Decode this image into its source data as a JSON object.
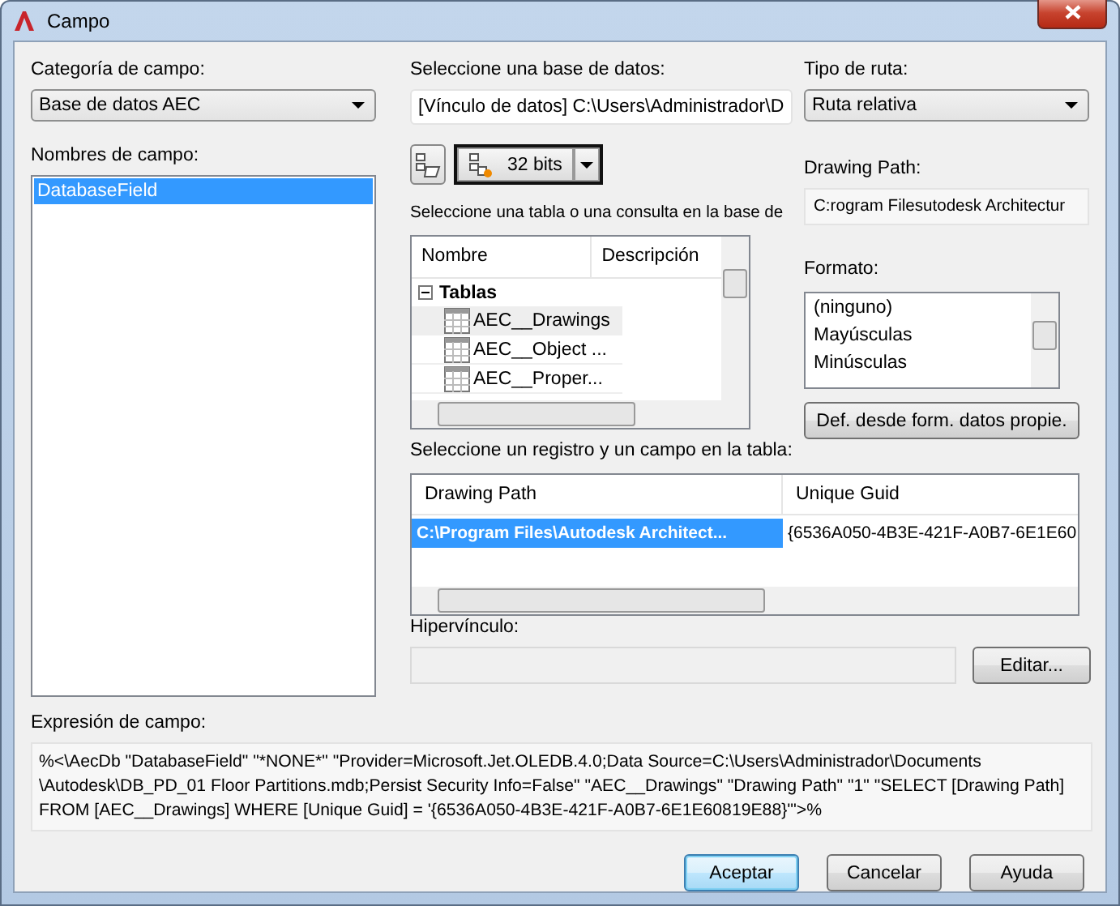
{
  "window": {
    "title": "Campo"
  },
  "category": {
    "label": "Categoría de campo:",
    "value": "Base de datos AEC"
  },
  "field_names": {
    "label": "Nombres de campo:",
    "items": [
      {
        "text": "DatabaseField",
        "selected": true
      }
    ]
  },
  "database": {
    "label": "Seleccione una base de datos:",
    "value": "[Vínculo de datos] C:\\Users\\Administrador\\D"
  },
  "bits_button": {
    "label": "32 bits"
  },
  "table_select": {
    "label": "Seleccione una tabla o una consulta en la base de",
    "columns": [
      "Nombre",
      "Descripción"
    ],
    "tree": [
      {
        "text": "Tablas",
        "expanded": true,
        "children": [
          {
            "text": "AEC__Drawings",
            "selected": true
          },
          {
            "text": "AEC__Object ...",
            "selected": false
          },
          {
            "text": "AEC__Proper...",
            "selected": false
          }
        ]
      }
    ]
  },
  "path_type": {
    "label": "Tipo de ruta:",
    "value": "Ruta relativa"
  },
  "drawing_path": {
    "label": "Drawing Path:",
    "value": "C:rogram Filesutodesk Architectur"
  },
  "format": {
    "label": "Formato:",
    "items": [
      {
        "text": "(ninguno)",
        "selected": false
      },
      {
        "text": "Mayúsculas",
        "selected": false
      },
      {
        "text": "Minúsculas",
        "selected": false
      }
    ]
  },
  "format_button": {
    "label": "Def. desde form. datos propie."
  },
  "records": {
    "label": "Seleccione un registro y un campo en la tabla:",
    "columns": [
      "Drawing Path",
      "Unique Guid"
    ],
    "rows": [
      {
        "cells": [
          {
            "text": "C:\\Program Files\\Autodesk Architect...",
            "selected": true
          },
          {
            "text": "{6536A050-4B3E-421F-A0B7-6E1E60",
            "selected": false
          }
        ]
      }
    ]
  },
  "hyperlink": {
    "label": "Hipervínculo:",
    "disabled": true,
    "button": "Editar..."
  },
  "expression": {
    "label": "Expresión de campo:",
    "lines": [
      "%<\\AecDb \"DatabaseField\" \"*NONE*\" \"Provider=Microsoft.Jet.OLEDB.4.0;Data Source=C:\\Users\\Administrador\\Documents",
      "\\Autodesk\\DB_PD_01 Floor Partitions.mdb;Persist Security Info=False\" \"AEC__Drawings\" \"Drawing Path\" \"1\" \"SELECT [Drawing Path]",
      "FROM [AEC__Drawings] WHERE [Unique Guid] = '{6536A050-4B3E-421F-A0B7-6E1E60819E88}'\">%"
    ]
  },
  "buttons": [
    {
      "label": "Aceptar",
      "default": true
    },
    {
      "label": "Cancelar",
      "default": false
    },
    {
      "label": "Ayuda",
      "default": false
    }
  ]
}
